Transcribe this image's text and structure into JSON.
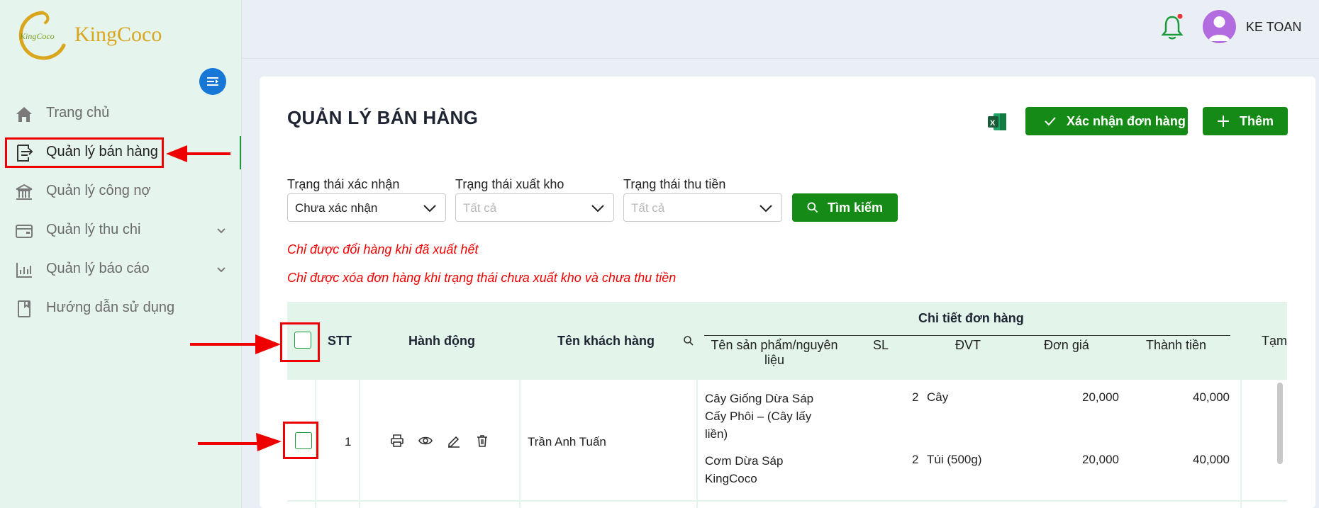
{
  "app": {
    "brand_name": "KingCoco",
    "logo_inner_text": "KingCoco",
    "accent_color": "#168a16",
    "brand_color": "#d9a61e"
  },
  "sidebar": {
    "items": [
      {
        "label": "Trang chủ",
        "icon": "home-icon"
      },
      {
        "label": "Quản lý bán hàng",
        "icon": "sales-icon",
        "active": true
      },
      {
        "label": "Quản lý công nợ",
        "icon": "bank-icon"
      },
      {
        "label": "Quản lý thu chi",
        "icon": "wallet-icon",
        "expandable": true
      },
      {
        "label": "Quản lý báo cáo",
        "icon": "report-icon",
        "expandable": true
      },
      {
        "label": "Hướng dẫn sử dụng",
        "icon": "book-icon"
      }
    ]
  },
  "topbar": {
    "user_name": "KE TOAN",
    "notification_dot": true
  },
  "page": {
    "title": "QUẢN LÝ BÁN HÀNG",
    "confirm_label": "Xác nhận đơn hàng",
    "add_label": "Thêm"
  },
  "filters": {
    "confirm_status": {
      "label": "Trạng thái xác nhận",
      "value": "Chưa xác nhận"
    },
    "export_status": {
      "label": "Trạng thái xuất kho",
      "placeholder": "Tất cả"
    },
    "payment_status": {
      "label": "Trạng thái thu tiền",
      "placeholder": "Tất cả"
    },
    "search_label": "Tìm kiếm"
  },
  "notes": [
    "Chỉ được đổi hàng khi đã xuất hết",
    "Chỉ được xóa đơn hàng khi trạng thái chưa xuất kho và chưa thu tiền"
  ],
  "table": {
    "headers": {
      "stt": "STT",
      "actions": "Hành động",
      "customer": "Tên khách hàng",
      "order_group": "Chi tiết đơn hàng",
      "product_line1": "Tên sản phẩm/nguyên",
      "product_line2": "liệu",
      "qty": "SL",
      "unit": "ĐVT",
      "price": "Đơn giá",
      "total": "Thành tiền",
      "extra": "Tạm"
    },
    "rows": [
      {
        "stt": "1",
        "customer": "Trần Anh Tuấn",
        "items": [
          {
            "name_lines": [
              "Cây Giống Dừa Sáp",
              "Cấy Phôi – (Cây lấy",
              "liền)"
            ],
            "qty": "2",
            "unit": "Cây",
            "price": "20,000",
            "total": "40,000"
          },
          {
            "name_lines": [
              "Cơm Dừa Sáp",
              "KingCoco"
            ],
            "qty": "2",
            "unit": "Túi (500g)",
            "price": "20,000",
            "total": "40,000"
          }
        ]
      }
    ]
  }
}
